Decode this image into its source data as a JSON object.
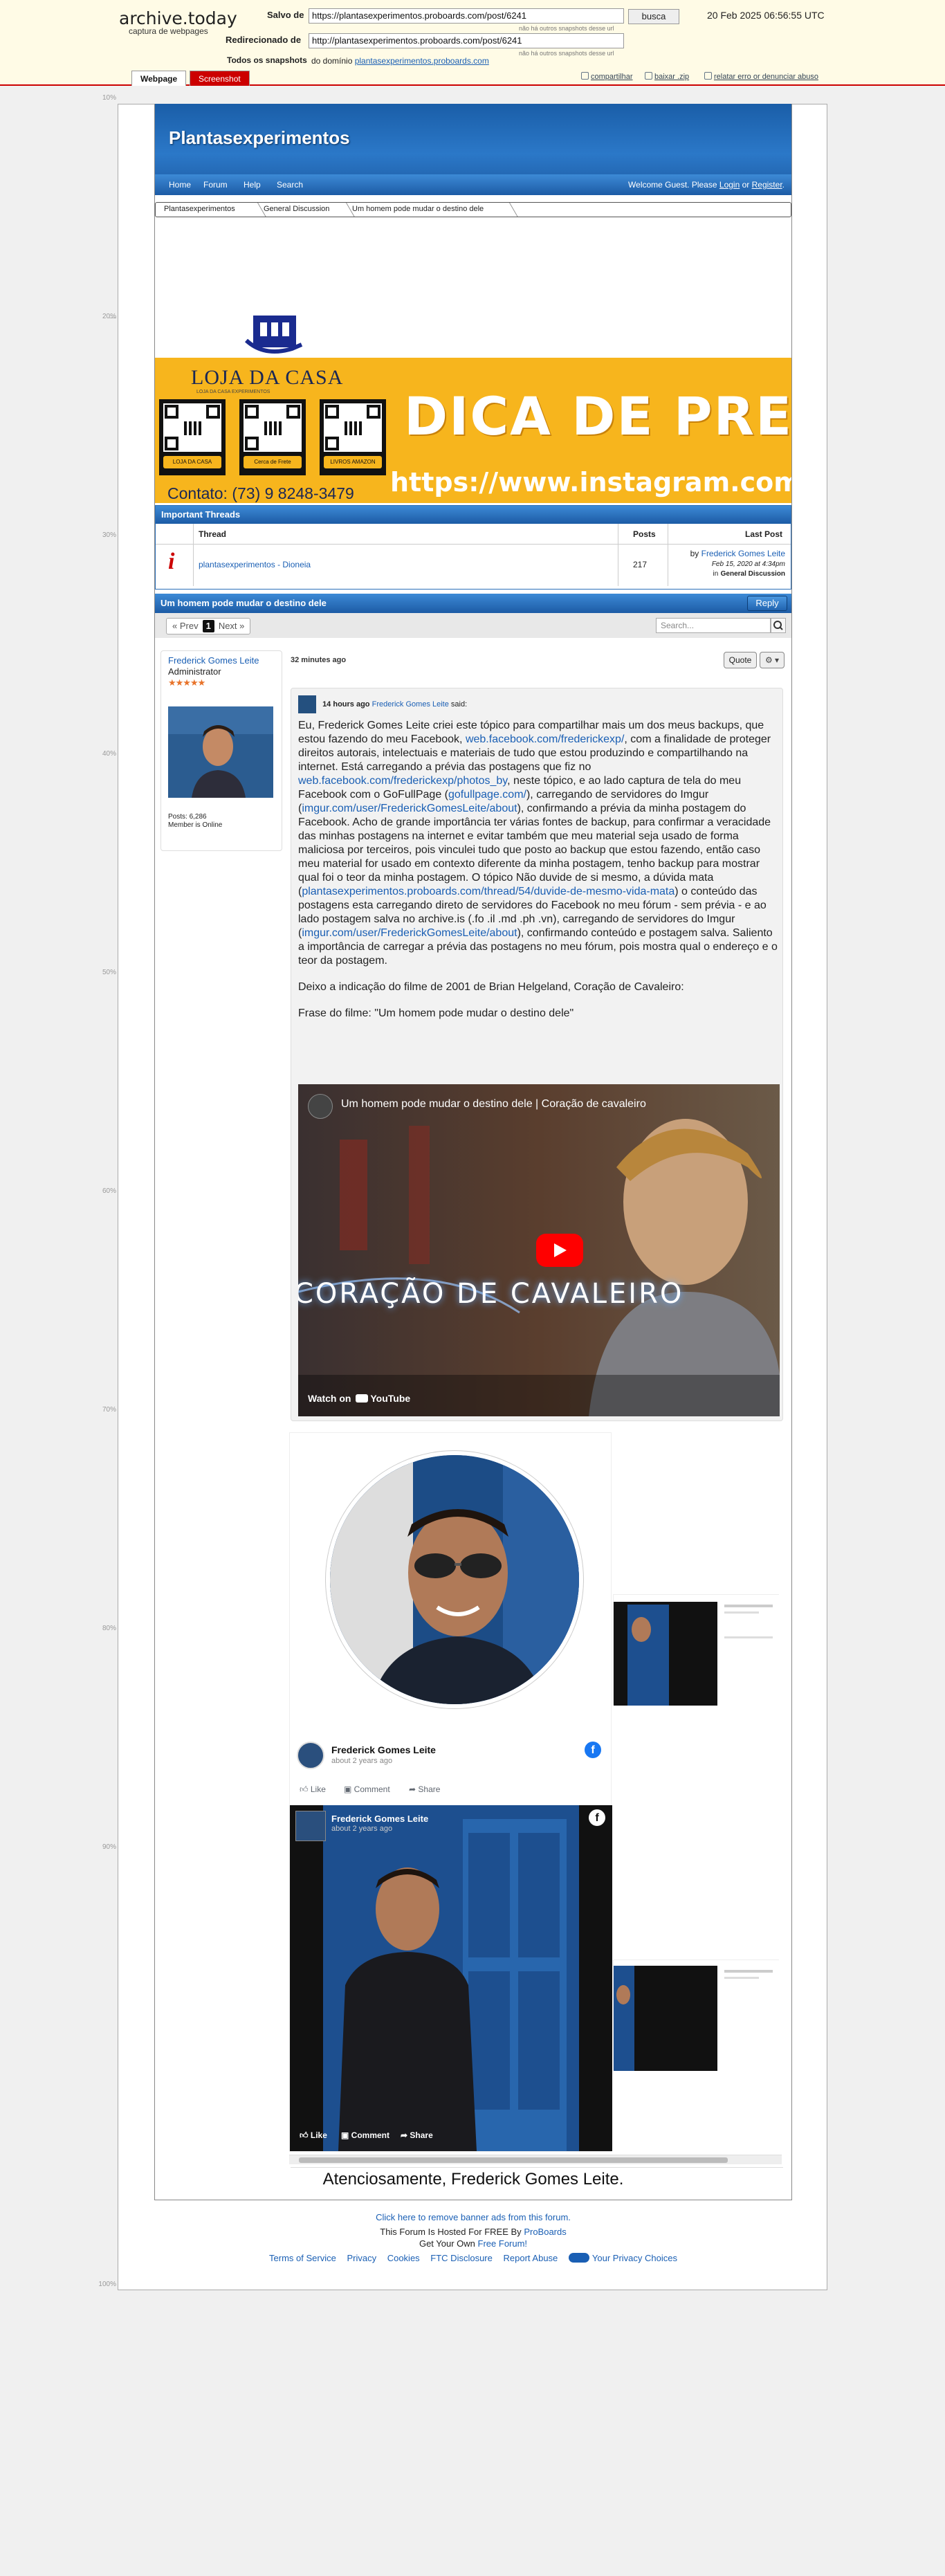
{
  "archive": {
    "logo": "archive.today",
    "subtitle": "captura de webpages",
    "saved_label": "Salvo de",
    "saved_url": "https://plantasexperimentos.proboards.com/post/6241",
    "saved_note": "não há outros snapshots desse url",
    "redirected_label": "Redirecionado de",
    "redirected_url": "http://plantasexperimentos.proboards.com/post/6241",
    "redirected_note": "não há outros snapshots desse url",
    "all_snapshots_label": "Todos os snapshots",
    "all_snapshots_prefix": "do domínio",
    "all_snapshots_domain": "plantasexperimentos.proboards.com",
    "search_button": "busca",
    "date": "20 Feb 2025 06:56:55 UTC",
    "tab_webpage": "Webpage",
    "tab_screenshot": "Screenshot",
    "share_link": "compartilhar",
    "download_link": "baixar .zip",
    "report_link": "relatar erro or denunciar abuso"
  },
  "ruler": [
    "10%",
    "20%",
    "30%",
    "40%",
    "50%",
    "60%",
    "70%",
    "80%",
    "90%",
    "100%"
  ],
  "forum": {
    "title": "Plantasexperimentos",
    "nav": [
      "Home",
      "Forum",
      "Help",
      "Search"
    ],
    "welcome_prefix": "Welcome Guest. Please",
    "login": "Login",
    "or": "or",
    "register": "Register",
    "breadcrumb": [
      "Plantasexperimentos",
      "General Discussion",
      "Um homem pode mudar o destino dele"
    ]
  },
  "banner": {
    "store": "LOJA DA CASA",
    "store_sub": "LOJA DA CASA EXPERIMENTOS",
    "qr_labels": [
      "LOJA DA CASA",
      "Cerca de Frete",
      "LIVROS AMAZON"
    ],
    "contact": "Contato: (73) 9 8248-3479",
    "headline": "DICA DE PRESENTE",
    "instagram": "https://www.instagram.com/lo"
  },
  "important": {
    "header": "Important Threads",
    "col_thread": "Thread",
    "col_posts": "Posts",
    "col_last": "Last Post",
    "row": {
      "title": "plantasexperimentos - Dioneia",
      "posts": "217",
      "by": "by",
      "author": "Frederick Gomes Leite",
      "date": "Feb 15, 2020 at 4:34pm",
      "in": "in",
      "board": "General Discussion"
    }
  },
  "thread": {
    "title": "Um homem pode mudar o destino dele",
    "reply": "Reply",
    "prev": "« Prev",
    "page": "1",
    "next": "Next »",
    "search_placeholder": "Search..."
  },
  "user": {
    "name": "Frederick Gomes Leite",
    "role": "Administrator",
    "stars": "★★★★★",
    "posts": "Posts: 6,286",
    "status": "Member is Online"
  },
  "post": {
    "time": "32 minutes ago",
    "quote_btn": "Quote",
    "quote_time": "14 hours ago",
    "quote_author": "Frederick Gomes Leite",
    "quote_said": "said:",
    "p1a": "Eu, Frederick Gomes Leite criei este tópico para compartilhar mais um dos meus backups, que estou fazendo do meu Facebook,",
    "link1": "web.facebook.com/frederickexp/",
    "p1b": ", com a finalidade de proteger direitos autorais, intelectuais e materiais de tudo que estou produzindo e compartilhando na internet. Está carregando a prévia das postagens que fiz no",
    "link2": "web.facebook.com/frederickexp/photos_by",
    "p1c": ", neste tópico, e ao lado captura de tela do meu Facebook com o GoFullPage (",
    "link3": "gofullpage.com/",
    "p1d": "), carregando de servidores do Imgur (",
    "link4": "imgur.com/user/FrederickGomesLeite/about",
    "p1e": "), confirmando a prévia da minha postagem do Facebook. Acho de grande importância ter várias fontes de backup, para confirmar a veracidade das minhas postagens na internet e evitar também que meu material seja usado de forma maliciosa por terceiros, pois vinculei tudo que posto ao backup que estou fazendo, então caso meu material for usado em contexto diferente da minha postagem, tenho backup para mostrar qual foi o teor da minha postagem. O tópico Não duvide de si mesmo, a dúvida mata (",
    "link5": "plantasexperimentos.proboards.com/thread/54/duvide-de-mesmo-vida-mata",
    "p1f": ") o conteúdo das postagens esta carregando direto de servidores do Facebook no meu fórum - sem prévia - e ao lado postagem salva no archive.is (.fo .il .md .ph .vn), carregando de servidores do Imgur (",
    "link6": "imgur.com/user/FrederickGomesLeite/about",
    "p1g": "), confirmando conteúdo e postagem salva. Saliento a importância de carregar a prévia das postagens no meu fórum, pois mostra qual o endereço e o teor da postagem.",
    "p2": "Deixo a indicação do filme de 2001 de Brian Helgeland, Coração de Cavaleiro:",
    "p3": "Frase do filme: \"Um homem pode mudar o destino dele\"",
    "video_title": "Um homem pode mudar o destino dele | Coração de cavaleiro",
    "video_overlay": "CORAÇÃO DE CAVALEIRO",
    "video_watch": "Watch on",
    "video_youtube": "YouTube",
    "fb_name": "Frederick Gomes Leite",
    "fb_time": "about 2 years ago",
    "fb_like": "Like",
    "fb_comment": "Comment",
    "fb_share": "Share",
    "signature": "Atenciosamente, Frederick Gomes Leite."
  },
  "footer": {
    "remove_ads": "Click here to remove banner ads from this forum.",
    "hosted_prefix": "This Forum Is Hosted For FREE By",
    "hosted_brand": "ProBoards",
    "get_own": "Get Your Own",
    "free_forum": "Free Forum!",
    "links": [
      "Terms of Service",
      "Privacy",
      "Cookies",
      "FTC Disclosure",
      "Report Abuse"
    ],
    "privacy_choices": "Your Privacy Choices"
  },
  "colors": {
    "forum_blue": "#1c5ba5",
    "banner_yellow": "#f7b51d",
    "archive_red": "#cc0000",
    "link_blue": "#1a5fb4"
  }
}
